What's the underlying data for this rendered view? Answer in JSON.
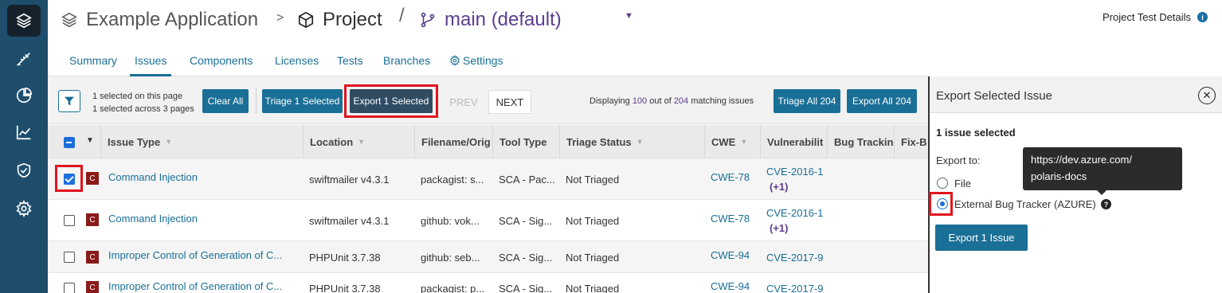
{
  "rail": {
    "items": [
      {
        "name": "layers-icon"
      },
      {
        "name": "ruler-icon"
      },
      {
        "name": "pie-chart-icon"
      },
      {
        "name": "trend-chart-icon"
      },
      {
        "name": "shield-check-icon"
      },
      {
        "name": "settings-gear-icon"
      }
    ]
  },
  "header": {
    "app_name": "Example Application",
    "sep1": ">",
    "project": "Project",
    "sep2": "/",
    "branch": "main (default)",
    "caret": "▼",
    "details_link": "Project Test Details",
    "info": "i"
  },
  "tabs": [
    "Summary",
    "Issues",
    "Components",
    "Licenses",
    "Tests",
    "Branches",
    "Settings"
  ],
  "toolbar": {
    "selected_page": "1 selected on this page",
    "selected_across": "1 selected across 3 pages",
    "clear_all": "Clear All",
    "triage_selected": "Triage 1 Selected",
    "export_selected": "Export 1 Selected",
    "prev": "PREV",
    "next": "NEXT",
    "display_pre": "Displaying ",
    "display_count": "100",
    "display_mid": " out of ",
    "display_total": "204",
    "display_post": " matching issues",
    "triage_all": "Triage All 204",
    "export_all": "Export All 204"
  },
  "table": {
    "headers": [
      "Issue Type",
      "Location",
      "Filename/Orig",
      "Tool Type",
      "Triage Status",
      "CWE",
      "Vulnerabilit",
      "Bug Trackin",
      "Fix-B"
    ],
    "rows": [
      {
        "issue": "Command Injection",
        "location": "swiftmailer v4.3.1",
        "filename": "packagist: s...",
        "tool": "SCA - Pac...",
        "triage": "Not Triaged",
        "cwe": "CWE-78",
        "vuln": "CVE-2016-1",
        "plus": "(+1)"
      },
      {
        "issue": "Command Injection",
        "location": "swiftmailer v4.3.1",
        "filename": "github: vok...",
        "tool": "SCA - Sig...",
        "triage": "Not Triaged",
        "cwe": "CWE-78",
        "vuln": "CVE-2016-1",
        "plus": "(+1)"
      },
      {
        "issue": "Improper Control of Generation of C...",
        "location": "PHPUnit 3.7.38",
        "filename": "github: seb...",
        "tool": "SCA - Sig...",
        "triage": "Not Triaged",
        "cwe": "CWE-94",
        "vuln": "CVE-2017-9",
        "plus": ""
      },
      {
        "issue": "Improper Control of Generation of C...",
        "location": "PHPUnit 3.7.38",
        "filename": "packagist: p...",
        "tool": "SCA - Sig...",
        "triage": "Not Triaged",
        "cwe": "CWE-94",
        "vuln": "CVE-2017-9",
        "plus": ""
      }
    ],
    "badge": "C"
  },
  "panel": {
    "title": "Export Selected Issue",
    "close": "✕",
    "count_num": "1",
    "count_label": " issue selected",
    "export_to": "Export to:",
    "option_file": "File",
    "option_external": "External Bug Tracker (AZURE)",
    "help": "?",
    "tooltip_line1": "https://dev.azure.com/",
    "tooltip_line2": "polaris-docs",
    "export_button": "Export 1 Issue"
  },
  "colors": {
    "rail": "#1f4e6d",
    "accent": "#1a6f96",
    "branch": "#5b3d8f",
    "highlight": "#e0141e"
  }
}
